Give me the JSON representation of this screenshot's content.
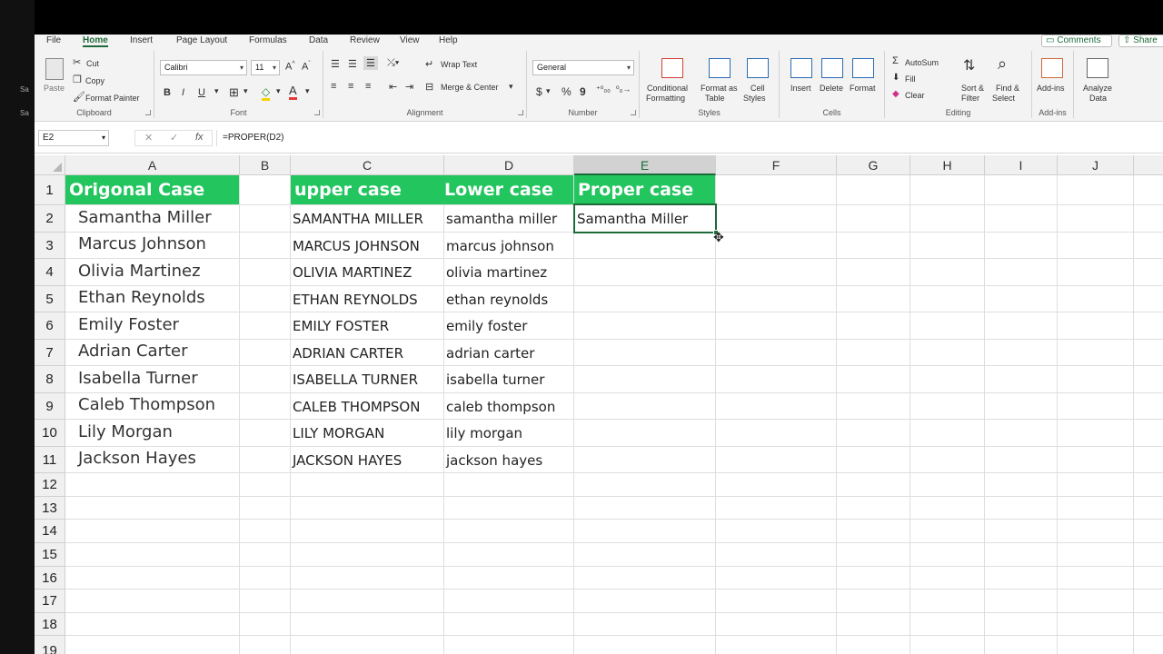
{
  "menu": {
    "tabs": [
      "File",
      "Home",
      "Insert",
      "Page Layout",
      "Formulas",
      "Data",
      "Review",
      "View",
      "Help"
    ],
    "active": "Home",
    "comments": "Comments",
    "share": "Share"
  },
  "ribbon": {
    "clipboard": {
      "paste": "Paste",
      "cut": "Cut",
      "copy": "Copy",
      "format_painter": "Format Painter",
      "label": "Clipboard"
    },
    "font": {
      "name": "Calibri",
      "size": "11",
      "bold": "B",
      "italic": "I",
      "underline": "U",
      "label": "Font"
    },
    "alignment": {
      "wrap_text": "Wrap Text",
      "merge_center": "Merge & Center",
      "label": "Alignment"
    },
    "number": {
      "format": "General",
      "currency": "$",
      "percent": "%",
      "comma": "9",
      "label": "Number"
    },
    "styles": {
      "conditional_1": "Conditional",
      "conditional_2": "Formatting",
      "format_table_1": "Format as",
      "format_table_2": "Table",
      "cell_styles_1": "Cell",
      "cell_styles_2": "Styles",
      "label": "Styles"
    },
    "cells": {
      "insert": "Insert",
      "delete": "Delete",
      "format": "Format",
      "label": "Cells"
    },
    "editing": {
      "autosum": "AutoSum",
      "fill": "Fill",
      "clear": "Clear",
      "sort_1": "Sort &",
      "sort_2": "Filter",
      "find_1": "Find &",
      "find_2": "Select",
      "label": "Editing"
    },
    "addins": {
      "addins": "Add-ins",
      "label": "Add-ins"
    },
    "analyze": {
      "line1": "Analyze",
      "line2": "Data"
    }
  },
  "formula_bar": {
    "name_box": "E2",
    "formula": "=PROPER(D2)"
  },
  "columns": [
    "A",
    "B",
    "C",
    "D",
    "E",
    "F",
    "G",
    "H",
    "I",
    "J"
  ],
  "selected_column": "E",
  "rows": [
    "1",
    "2",
    "3",
    "4",
    "5",
    "6",
    "7",
    "8",
    "9",
    "10",
    "11",
    "12",
    "13",
    "14",
    "15",
    "16",
    "17",
    "18",
    "19"
  ],
  "sheet": {
    "header": {
      "original": "Origonal Case",
      "upper": "upper case",
      "lower": "Lower case",
      "proper": "Proper case"
    },
    "original": [
      "Samantha Miller",
      "Marcus Johnson",
      "Olivia Martinez",
      "Ethan Reynolds",
      "Emily Foster",
      "Adrian Carter",
      "Isabella Turner",
      "Caleb Thompson",
      "Lily Morgan",
      "Jackson Hayes"
    ],
    "upper": [
      "SAMANTHA MILLER",
      "MARCUS JOHNSON",
      "OLIVIA MARTINEZ",
      "ETHAN REYNOLDS",
      "EMILY FOSTER",
      "ADRIAN CARTER",
      "ISABELLA TURNER",
      "CALEB THOMPSON",
      "LILY MORGAN",
      "JACKSON HAYES"
    ],
    "lower": [
      "samantha miller",
      "marcus johnson",
      "olivia martinez",
      "ethan reynolds",
      "emily foster",
      "adrian carter",
      "isabella turner",
      "caleb thompson",
      "lily morgan",
      "jackson hayes"
    ],
    "proper": [
      "Samantha Miller"
    ]
  },
  "colors": {
    "header_green": "#22c55e",
    "excel_green": "#1d6b3a"
  }
}
